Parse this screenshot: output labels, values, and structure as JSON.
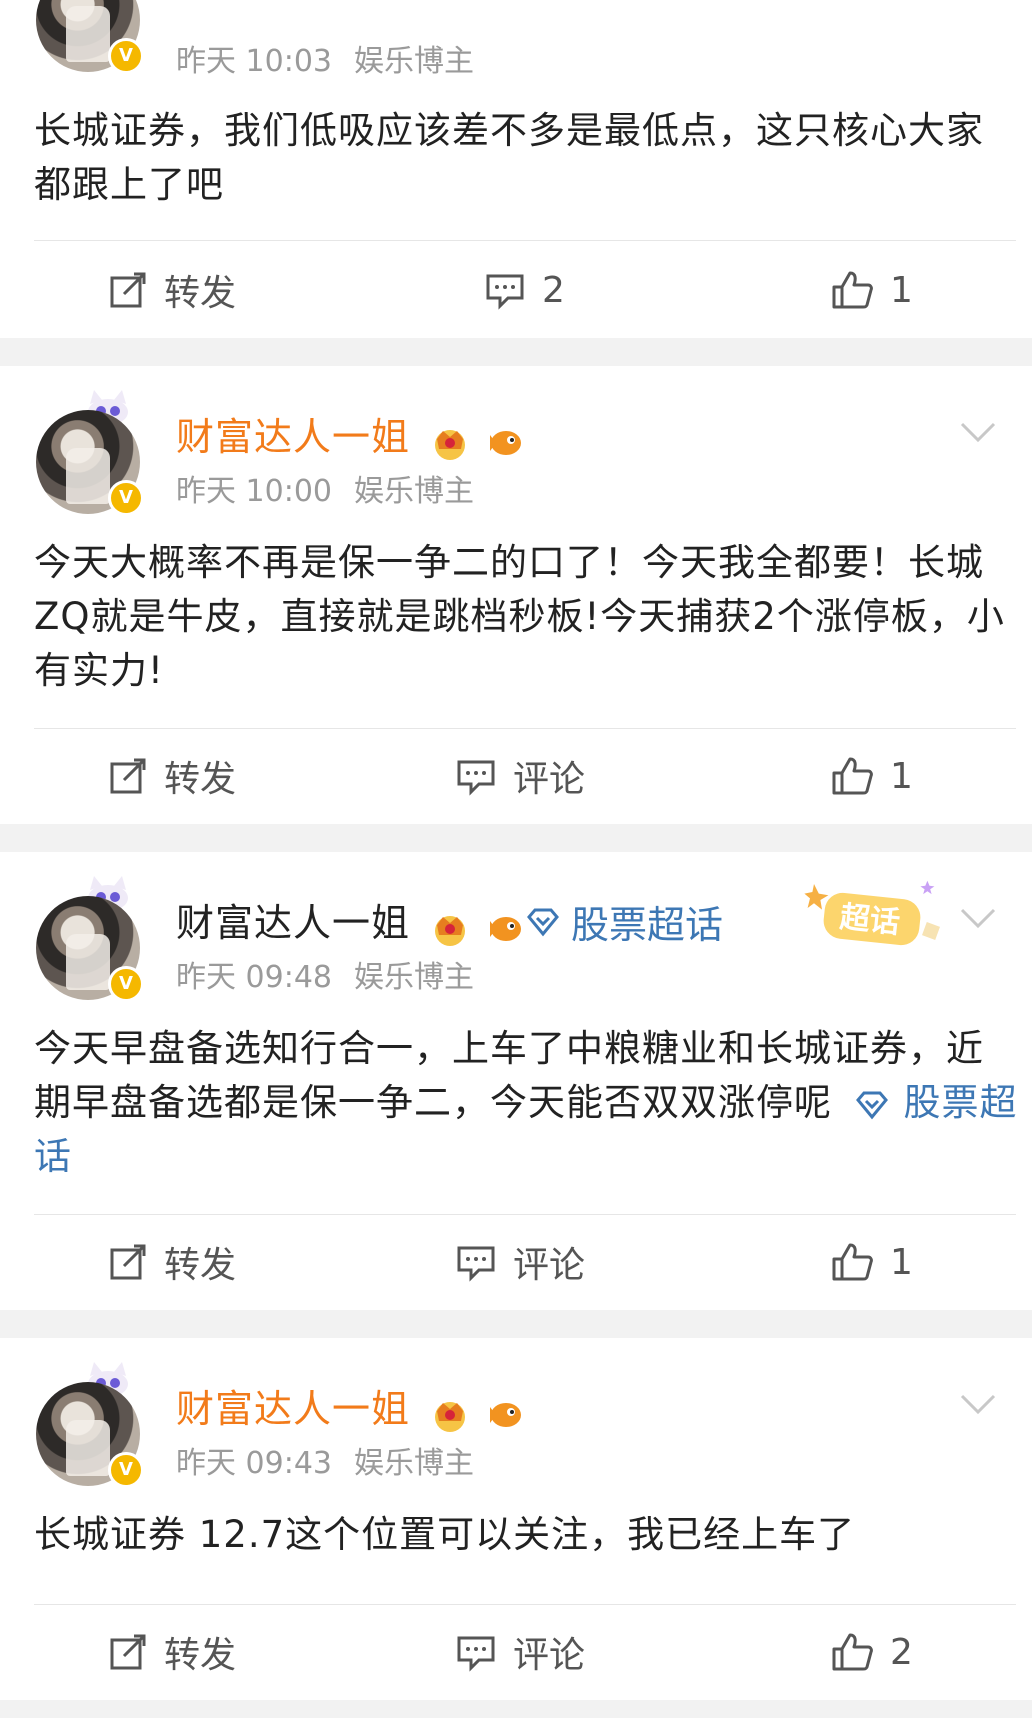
{
  "posts": [
    {
      "author": "",
      "time": "昨天 10:03",
      "source": "娱乐博主",
      "text": "长城证券，我们低吸应该差不多是最低点，这只核心大家都跟上了吧",
      "actions": {
        "repost": "转发",
        "comment": "2",
        "like": "1"
      }
    },
    {
      "author": "财富达人一姐",
      "time": "昨天 10:00",
      "source": "娱乐博主",
      "text": "今天大概率不再是保一争二的口了！今天我全都要！长城ZQ就是牛皮，直接就是跳档秒板!今天捕获2个涨停板，小有实力!",
      "actions": {
        "repost": "转发",
        "comment": "评论",
        "like": "1"
      }
    },
    {
      "author": "财富达人一姐",
      "topic": "股票超话",
      "badge_text": "超话",
      "time": "昨天 09:48",
      "source": "娱乐博主",
      "text": "今天早盘备选知行合一，上车了中粮糖业和长城证券，近期早盘备选都是保一争二，今天能否双双涨停呢",
      "text_link": "股票超话",
      "actions": {
        "repost": "转发",
        "comment": "评论",
        "like": "1"
      }
    },
    {
      "author": "财富达人一姐",
      "time": "昨天 09:43",
      "source": "娱乐博主",
      "text": "长城证券 12.7这个位置可以关注，我已经上车了",
      "actions": {
        "repost": "转发",
        "comment": "评论",
        "like": "2"
      }
    }
  ],
  "icons": {
    "verified": "verified-v-icon",
    "crown": "crown-badge-icon",
    "fish": "fish-badge-icon",
    "diamond": "supertopic-diamond-icon",
    "repost": "repost-icon",
    "comment": "comment-icon",
    "like": "thumbs-up-icon",
    "menu": "chevron-down-icon"
  },
  "colors": {
    "author": "#f27b1a",
    "link": "#3d77b4",
    "meta": "#9a9a9a",
    "verified": "#f5b800"
  }
}
